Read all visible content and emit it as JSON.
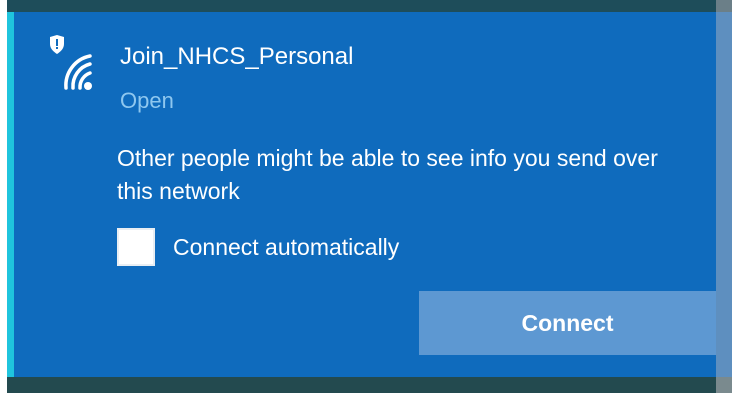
{
  "network": {
    "name": "Join_NHCS_Personal",
    "status": "Open",
    "warning": "Other people might be able to see info you send over this network",
    "icon": "wifi-shield-icon"
  },
  "options": {
    "connect_automatically_label": "Connect automatically",
    "connect_automatically_checked": false
  },
  "actions": {
    "connect_label": "Connect"
  },
  "colors": {
    "panel_background": "#0f6bbd",
    "accent": "#1fc4dd",
    "status_text": "#8ec7ef",
    "button_background": "#5d98d2"
  }
}
